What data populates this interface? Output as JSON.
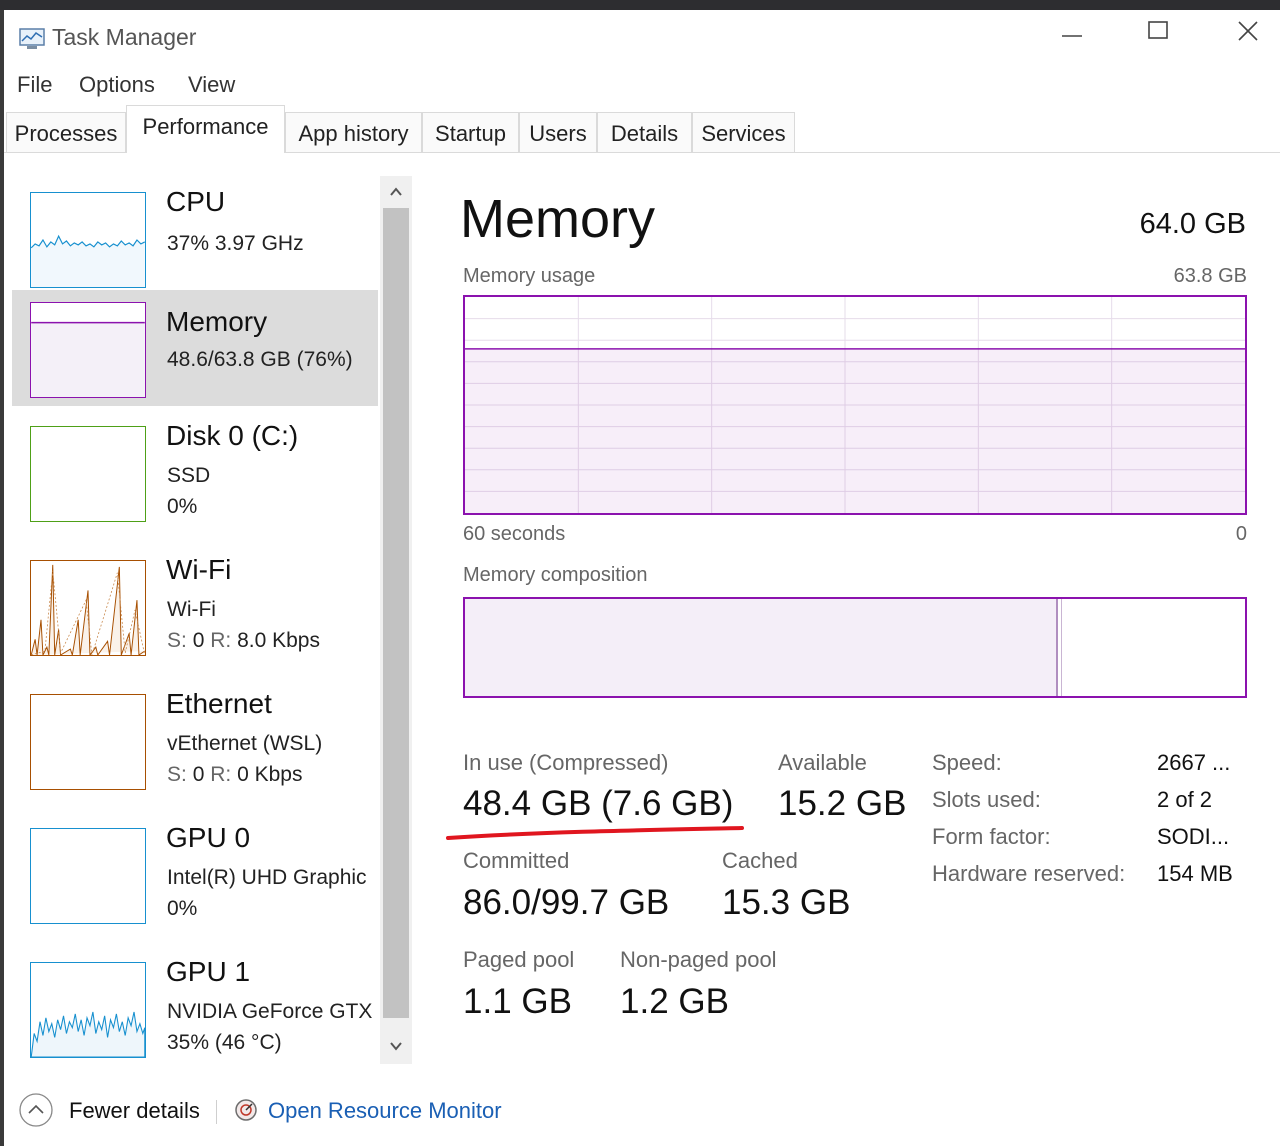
{
  "window": {
    "title": "Task Manager"
  },
  "menu": [
    "File",
    "Options",
    "View"
  ],
  "tabs": [
    "Processes",
    "Performance",
    "App history",
    "Startup",
    "Users",
    "Details",
    "Services"
  ],
  "active_tab": "Performance",
  "colors": {
    "memory_accent": "#8b12ae",
    "cpu_accent": "#1790cf",
    "disk_accent": "#4ea017",
    "network_accent": "#a74f01",
    "gpu_accent": "#1790cf",
    "selected_bg": "#dcdcdc",
    "link": "#1a5fb4",
    "annotation_red": "#e0161f"
  },
  "sidebar": {
    "cpu": {
      "title": "CPU",
      "line1": "37%  3.97 GHz"
    },
    "memory": {
      "title": "Memory",
      "line1": "48.6/63.8 GB (76%)"
    },
    "disk": {
      "title": "Disk 0 (C:)",
      "line1": "SSD",
      "line2": "0%"
    },
    "wifi": {
      "title": "Wi-Fi",
      "line1": "Wi-Fi",
      "s_label": "S:",
      "s_value": "0",
      "r_label": "R:",
      "r_value": "8.0 Kbps"
    },
    "ethernet": {
      "title": "Ethernet",
      "line1": "vEthernet (WSL)",
      "s_label": "S:",
      "s_value": "0",
      "r_label": "R:",
      "r_value": "0 Kbps"
    },
    "gpu0": {
      "title": "GPU 0",
      "line1": "Intel(R) UHD Graphic",
      "line2": "0%"
    },
    "gpu1": {
      "title": "GPU 1",
      "line1": "NVIDIA GeForce GTX",
      "line2": "35% (46 °C)"
    }
  },
  "main": {
    "title": "Memory",
    "total": "64.0 GB",
    "usage_label": "Memory usage",
    "usage_max": "63.8 GB",
    "axis_left": "60 seconds",
    "axis_right": "0",
    "composition_label": "Memory composition",
    "usage_fraction": 0.76,
    "stats": {
      "in_use_label": "In use (Compressed)",
      "in_use_value": "48.4 GB (7.6 GB)",
      "available_label": "Available",
      "available_value": "15.2 GB",
      "committed_label": "Committed",
      "committed_value": "86.0/99.7 GB",
      "cached_label": "Cached",
      "cached_value": "15.3 GB",
      "paged_label": "Paged pool",
      "paged_value": "1.1 GB",
      "nonpaged_label": "Non-paged pool",
      "nonpaged_value": "1.2 GB"
    },
    "specs": [
      {
        "label": "Speed:",
        "value": "2667 ..."
      },
      {
        "label": "Slots used:",
        "value": "2 of 2"
      },
      {
        "label": "Form factor:",
        "value": "SODI..."
      },
      {
        "label": "Hardware reserved:",
        "value": "154 MB"
      }
    ]
  },
  "footer": {
    "fewer_details": "Fewer details",
    "open_resource_monitor": "Open Resource Monitor"
  }
}
